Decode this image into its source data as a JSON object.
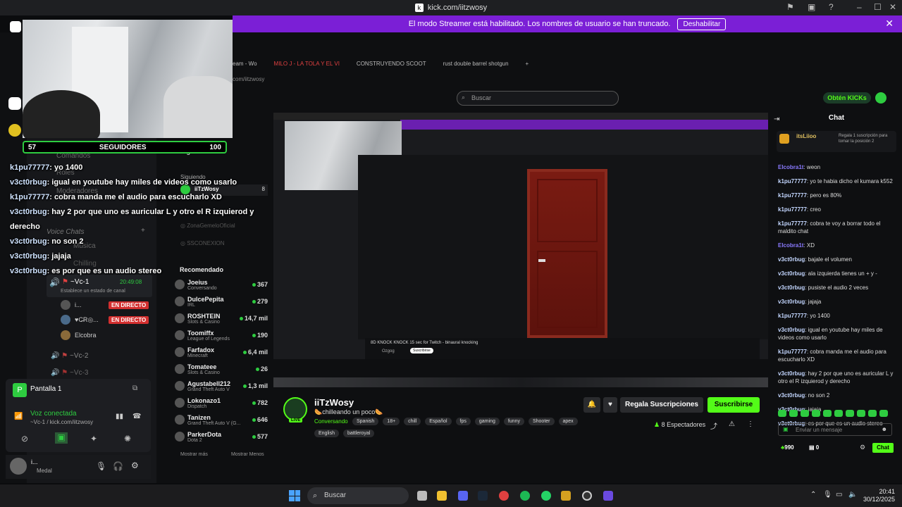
{
  "browser": {
    "url": "kick.com/iitzwosy"
  },
  "banner": {
    "text": "El modo Streamer está habilitado. Los nombres de usuario se han truncado.",
    "button": "Deshabilitar"
  },
  "tabs": [
    "eam - Wo",
    "MILO J - LA TOLA Y EL VI",
    "CONSTRUYENDO SCOOT",
    "rust double barrel shotgun"
  ],
  "address": "com/iitzwosy",
  "overlay": {
    "followers": {
      "left": "57",
      "label": "SEGUIDORES",
      "right": "100"
    },
    "messages": [
      {
        "user": "k1pu77777",
        "text": ": yo 1400"
      },
      {
        "user": "v3ct0rbug",
        "text": ": igual en youtube hay miles de videos como usarlo"
      },
      {
        "user": "k1pu77777",
        "text": ": cobra manda me el audio para escucharlo XD"
      },
      {
        "user": "v3ct0rbug",
        "text": ": hay 2 por que uno es auricular L y otro el R izquierod y derecho"
      },
      {
        "user": "v3ct0rbug",
        "text": ": no son 2"
      },
      {
        "user": "v3ct0rbug",
        "text": ": jajaja"
      },
      {
        "user": "v3ct0rbug",
        "text": ": es por que es un audio stereo"
      }
    ]
  },
  "discord": {
    "ghost": [
      "Comandos",
      "Roles",
      "Moderadores",
      "Voice Chats",
      "Musica",
      "Chilling"
    ],
    "vc1": {
      "name": "~Vc-1",
      "time": "20:49:08",
      "status": "Establece un estado de canal"
    },
    "members": [
      {
        "name": "i...",
        "badge": "EN DIRECTO"
      },
      {
        "name": "♥C̶R◎...",
        "badge": "EN DIRECTO"
      },
      {
        "name": "Elcobra",
        "badge": ""
      }
    ],
    "vc2": "~Vc-2",
    "vc3": "~Vc-3",
    "screen_share": "Pantalla 1",
    "voice": {
      "status": "Voz conectada",
      "channel": "~Vc-1 / kick.com/iitzwosy"
    },
    "user": {
      "name": "i...",
      "sub": "Medal"
    }
  },
  "sidebar": {
    "following": "Siguiendo",
    "followingSub": "Siguiendo",
    "channels": [
      {
        "name": "iiTzWosy",
        "count": "8"
      },
      {
        "name": "ZonaGemeloOficial",
        "count": ""
      },
      {
        "name": "SSCONEXION",
        "count": ""
      }
    ],
    "recommended_title": "Recomendado",
    "recommended": [
      {
        "name": "Joeius",
        "cat": "Conversando",
        "count": "367"
      },
      {
        "name": "DulcePepita",
        "cat": "IRL",
        "count": "279"
      },
      {
        "name": "ROSHTEIN",
        "cat": "Slots & Casino",
        "count": "14,7 mil"
      },
      {
        "name": "Toomiffx",
        "cat": "League of Legends",
        "count": "190"
      },
      {
        "name": "Farfadox",
        "cat": "Minecraft",
        "count": "6,4 mil"
      },
      {
        "name": "Tomateee",
        "cat": "Slots & Casino",
        "count": "26"
      },
      {
        "name": "Agustabell212",
        "cat": "Grand Theft Auto V",
        "count": "1,3 mil"
      },
      {
        "name": "Lokonazo1",
        "cat": "Dispatch",
        "count": "782"
      },
      {
        "name": "Tanizen",
        "cat": "Grand Theft Auto V (G...",
        "count": "646"
      },
      {
        "name": "ParkerDota",
        "cat": "Dota 2",
        "count": "577"
      }
    ],
    "more": "Mostrar más",
    "less": "Mostrar Menos"
  },
  "search": {
    "placeholder": "Buscar"
  },
  "kicks": "Obtén KICKs",
  "stream": {
    "inner_video_title": "8D KNOCK KNOCK 15 sec for Twitch - binaural knocking",
    "inner_channel": "Ozgog",
    "inner_subscribe": "Suscribirse"
  },
  "streamer": {
    "name": "iiTzWosy",
    "title": "🌭chilleando un poco🌭",
    "category": "Conversando",
    "tags": [
      "Spanish",
      "18+",
      "chill",
      "Español",
      "fps",
      "gaming",
      "funny",
      "Shooter",
      "apex",
      "English",
      "battleroyal"
    ],
    "live": "LIVE",
    "viewers": "8 Espectadores",
    "gift": "Regala Suscripciones",
    "subscribe": "Suscribirse"
  },
  "chat": {
    "title": "Chat",
    "pinned": {
      "user": "itsLiioo",
      "text": "Regala 1 suscripción para tomar la posición 2"
    },
    "messages": [
      {
        "user": "Elcobra1t",
        "text": ": weon"
      },
      {
        "user": "k1pu77777",
        "text": ": yo te habia dicho el kumara k552"
      },
      {
        "user": "k1pu77777",
        "text": ": pero es 80%"
      },
      {
        "user": "k1pu77777",
        "text": ": creo"
      },
      {
        "user": "k1pu77777",
        "text": ": cobra te voy a borrar todo el maldito chat"
      },
      {
        "user": "Elcobra1t",
        "text": ": XD"
      },
      {
        "user": "v3ct0rbug",
        "text": ": bajale el volumen"
      },
      {
        "user": "v3ct0rbug",
        "text": ": ala izquierda tienes un + y -"
      },
      {
        "user": "v3ct0rbug",
        "text": ": pusiste el audio 2 veces"
      },
      {
        "user": "v3ct0rbug",
        "text": ": jajaja"
      },
      {
        "user": "k1pu77777",
        "text": ": yo 1400"
      },
      {
        "user": "v3ct0rbug",
        "text": ": igual en youtube hay miles de videos como usarlo"
      },
      {
        "user": "k1pu77777",
        "text": ": cobra manda me el audio para escucharlo XD"
      },
      {
        "user": "v3ct0rbug",
        "text": ": hay 2 por que uno es auricular L y otro el R izquierod y derecho"
      },
      {
        "user": "v3ct0rbug",
        "text": ": no son 2"
      },
      {
        "user": "v3ct0rbug",
        "text": ": jajaja"
      },
      {
        "user": "v3ct0rbug",
        "text": ": es por que es un audio stereo"
      }
    ],
    "placeholder": "Enviar un mensaje",
    "kicks": "990",
    "gifts": "0",
    "send": "Chat"
  },
  "taskbar": {
    "search": "Buscar",
    "time": "20:41",
    "date": "30/12/2025"
  }
}
